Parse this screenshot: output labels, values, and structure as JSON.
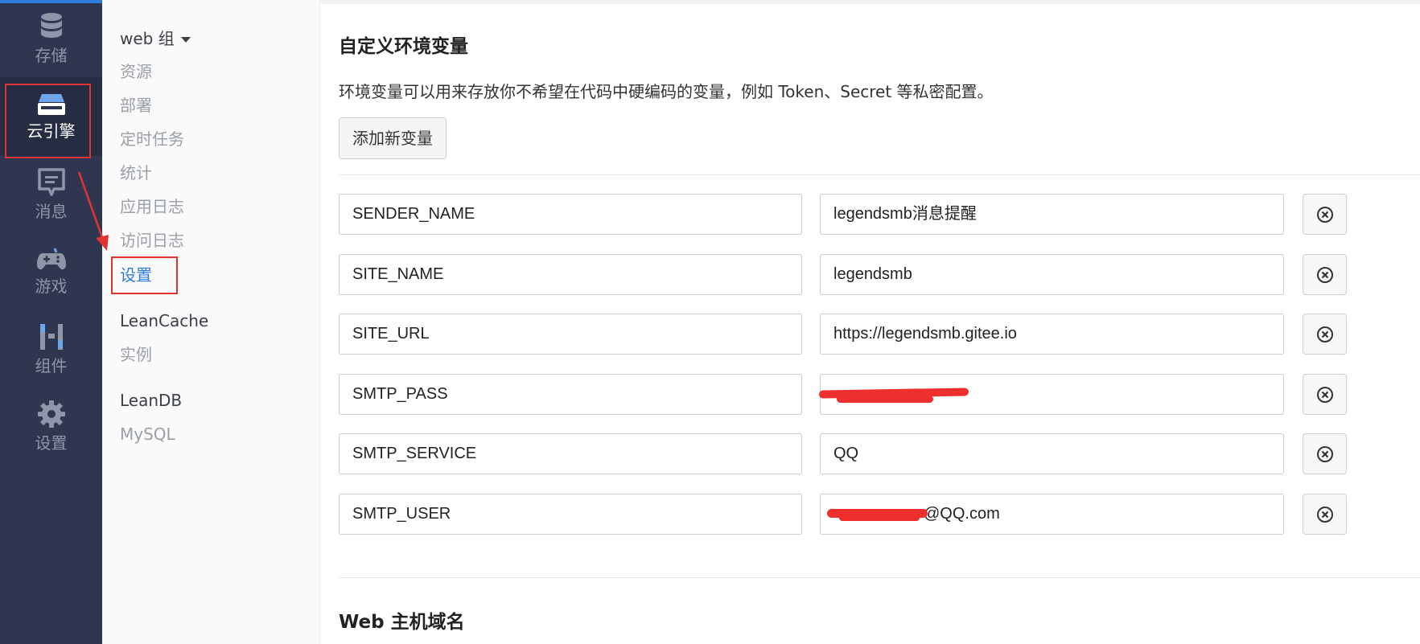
{
  "rail": {
    "items": [
      {
        "label": "存储",
        "icon": "database-icon"
      },
      {
        "label": "云引擎",
        "icon": "engine-icon"
      },
      {
        "label": "消息",
        "icon": "message-icon"
      },
      {
        "label": "游戏",
        "icon": "gamepad-icon"
      },
      {
        "label": "组件",
        "icon": "components-icon"
      },
      {
        "label": "设置",
        "icon": "gear-icon"
      }
    ]
  },
  "subnav": {
    "group": "web 组",
    "items": [
      "资源",
      "部署",
      "定时任务",
      "统计",
      "应用日志",
      "访问日志",
      "设置"
    ],
    "leancache": "LeanCache",
    "leancache_items": [
      "实例"
    ],
    "leandb": "LeanDB",
    "leandb_items": [
      "MySQL"
    ]
  },
  "main": {
    "env_title": "自定义环境变量",
    "env_desc": "环境变量可以用来存放你不希望在代码中硬编码的变量，例如 Token、Secret 等私密配置。",
    "add_button": "添加新变量",
    "vars": [
      {
        "key": "SENDER_NAME",
        "value": "legendsmb消息提醒"
      },
      {
        "key": "SITE_NAME",
        "value": "legendsmb"
      },
      {
        "key": "SITE_URL",
        "value": "https://legendsmb.gitee.io"
      },
      {
        "key": "SMTP_PASS",
        "value": ""
      },
      {
        "key": "SMTP_SERVICE",
        "value": "QQ"
      },
      {
        "key": "SMTP_USER",
        "value": "@QQ.com"
      }
    ],
    "web_title": "Web 主机域名"
  },
  "colors": {
    "rail_bg": "#2f3650",
    "accent": "#2d7de0",
    "annotation": "#e23333",
    "redaction": "#ef2e2e"
  }
}
